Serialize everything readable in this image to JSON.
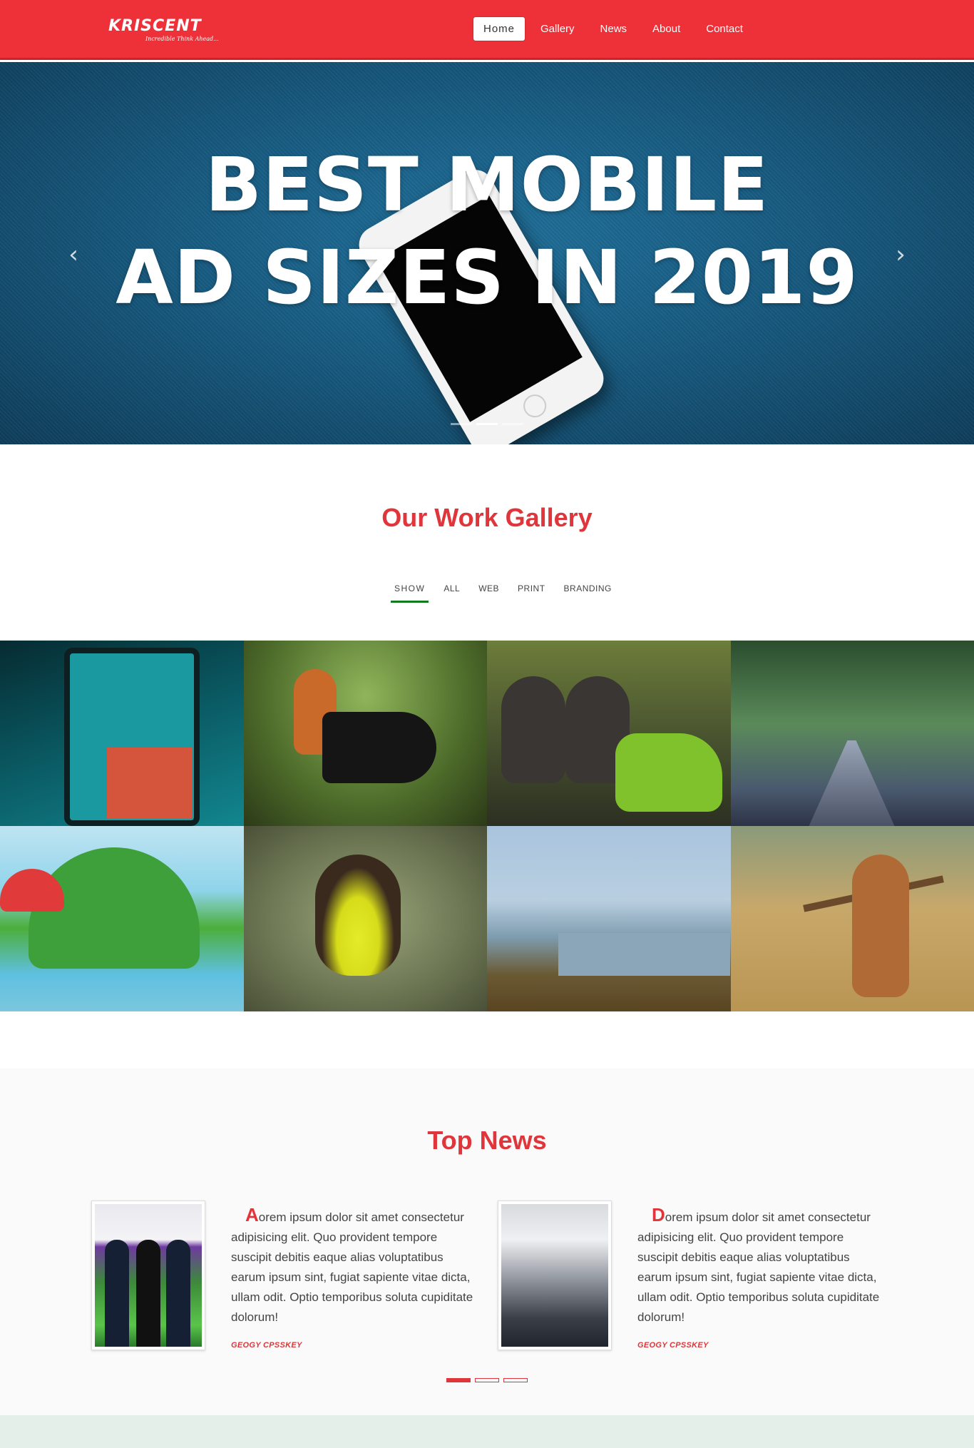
{
  "brand": {
    "name": "KRISCENT",
    "tagline": "Incredible Think Ahead...",
    "accent_color": "#ee3138",
    "title_color": "#e0353a",
    "filter_underline_color": "#12791e"
  },
  "nav": {
    "items": [
      {
        "label": "Home",
        "active": true
      },
      {
        "label": "Gallery",
        "active": false
      },
      {
        "label": "News",
        "active": false
      },
      {
        "label": "About",
        "active": false
      },
      {
        "label": "Contact",
        "active": false
      }
    ]
  },
  "hero": {
    "line1": "BEST MOBILE",
    "line2": "AD SIZES IN 2019",
    "prev_icon": "chevron-left-icon",
    "next_icon": "chevron-right-icon",
    "prev_glyph": "‹",
    "next_glyph": "›",
    "slide_count": 3,
    "active_slide": 2
  },
  "gallery": {
    "title": "Our Work Gallery",
    "filters": [
      "SHOW",
      "ALL",
      "WEB",
      "PRINT",
      "BRANDING"
    ],
    "selected_filter": "SHOW",
    "tiles": [
      "vero-app-phone",
      "squirrel-camera",
      "monkeys-motorbike",
      "forest-road",
      "cartoon-mushroom-house",
      "yellow-sunbird",
      "river-landscape",
      "dog-with-stick"
    ]
  },
  "news": {
    "title": "Top News",
    "items": [
      {
        "drop_cap": "A",
        "text": "orem ipsum dolor sit amet consectetur adipisicing elit. Quo provident tempore suscipit debitis eaque alias voluptatibus earum ipsum sint, fugiat sapiente vitae dicta, ullam odit. Optio temporibus soluta cupiditate dolorum!",
        "author": "GEOGY CPSSKEY",
        "image": "team-photo"
      },
      {
        "drop_cap": "D",
        "text": "orem ipsum dolor sit amet consectetur adipisicing elit. Quo provident tempore suscipit debitis eaque alias voluptatibus earum ipsum sint, fugiat sapiente vitae dicta, ullam odit. Optio temporibus soluta cupiditate dolorum!",
        "author": "GEOGY CPSSKEY",
        "image": "office-photo"
      }
    ],
    "page_count": 3,
    "active_page": 1
  }
}
